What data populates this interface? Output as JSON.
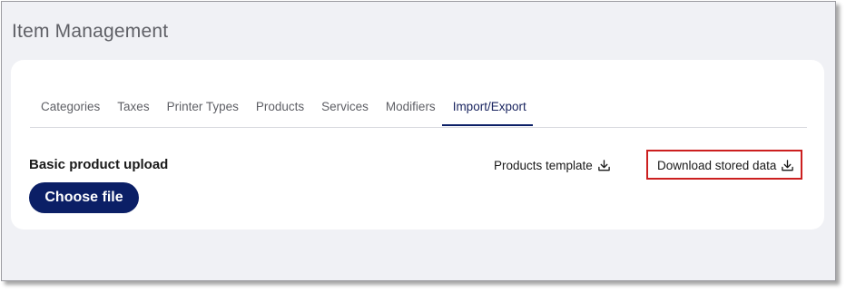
{
  "header": {
    "title": "Item Management"
  },
  "tabs": [
    {
      "label": "Categories"
    },
    {
      "label": "Taxes"
    },
    {
      "label": "Printer Types"
    },
    {
      "label": "Products"
    },
    {
      "label": "Services"
    },
    {
      "label": "Modifiers"
    },
    {
      "label": "Import/Export",
      "active": true
    }
  ],
  "upload": {
    "title": "Basic product upload",
    "choose_label": "Choose file"
  },
  "links": {
    "template_label": "Products template",
    "download_label": "Download stored data"
  },
  "colors": {
    "accent": "#0b1f66",
    "highlight": "#cc1f1f",
    "background": "#f0f1f5"
  },
  "icons": {
    "download": "download-icon"
  }
}
